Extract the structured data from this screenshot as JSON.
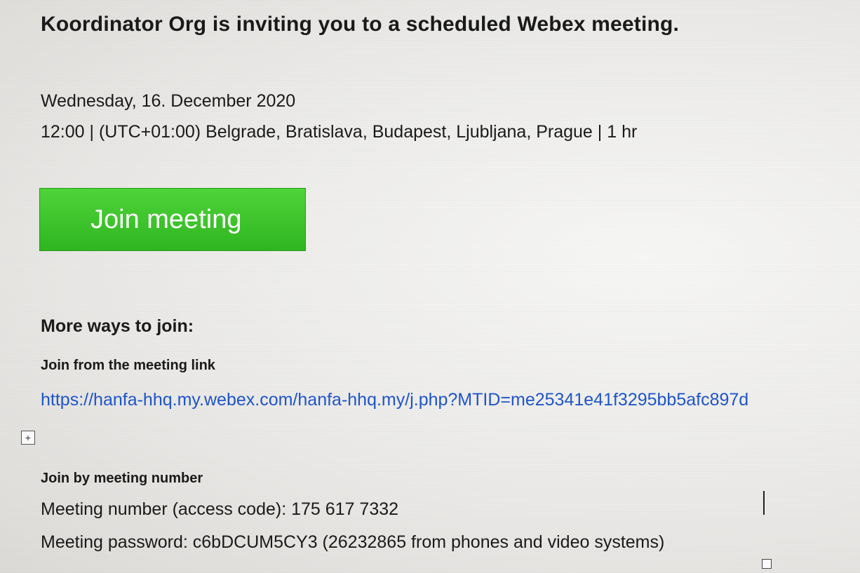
{
  "invite": {
    "heading": "Koordinator Org is inviting you to a scheduled Webex meeting.",
    "date": "Wednesday, 16. December 2020",
    "time_zone_line": "12:00 | (UTC+01:00) Belgrade, Bratislava, Budapest, Ljubljana, Prague | 1 hr"
  },
  "join_button": {
    "label": "Join meeting",
    "color": "#3cc42c"
  },
  "more_ways": {
    "title": "More ways to join:",
    "link_section_title": "Join from the meeting link",
    "meeting_link": "https://hanfa-hhq.my.webex.com/hanfa-hhq.my/j.php?MTID=me25341e41f3295bb5afc897d",
    "link_color": "#1f55c8",
    "number_section_title": "Join by meeting number",
    "meeting_number_line": "Meeting number (access code): 175 617 7332",
    "meeting_password_line": "Meeting password: c6bDCUM5CY3 (26232865 from phones and video systems)"
  },
  "icons": {
    "move_handle": "move-handle-icon",
    "move_glyph": "+"
  }
}
